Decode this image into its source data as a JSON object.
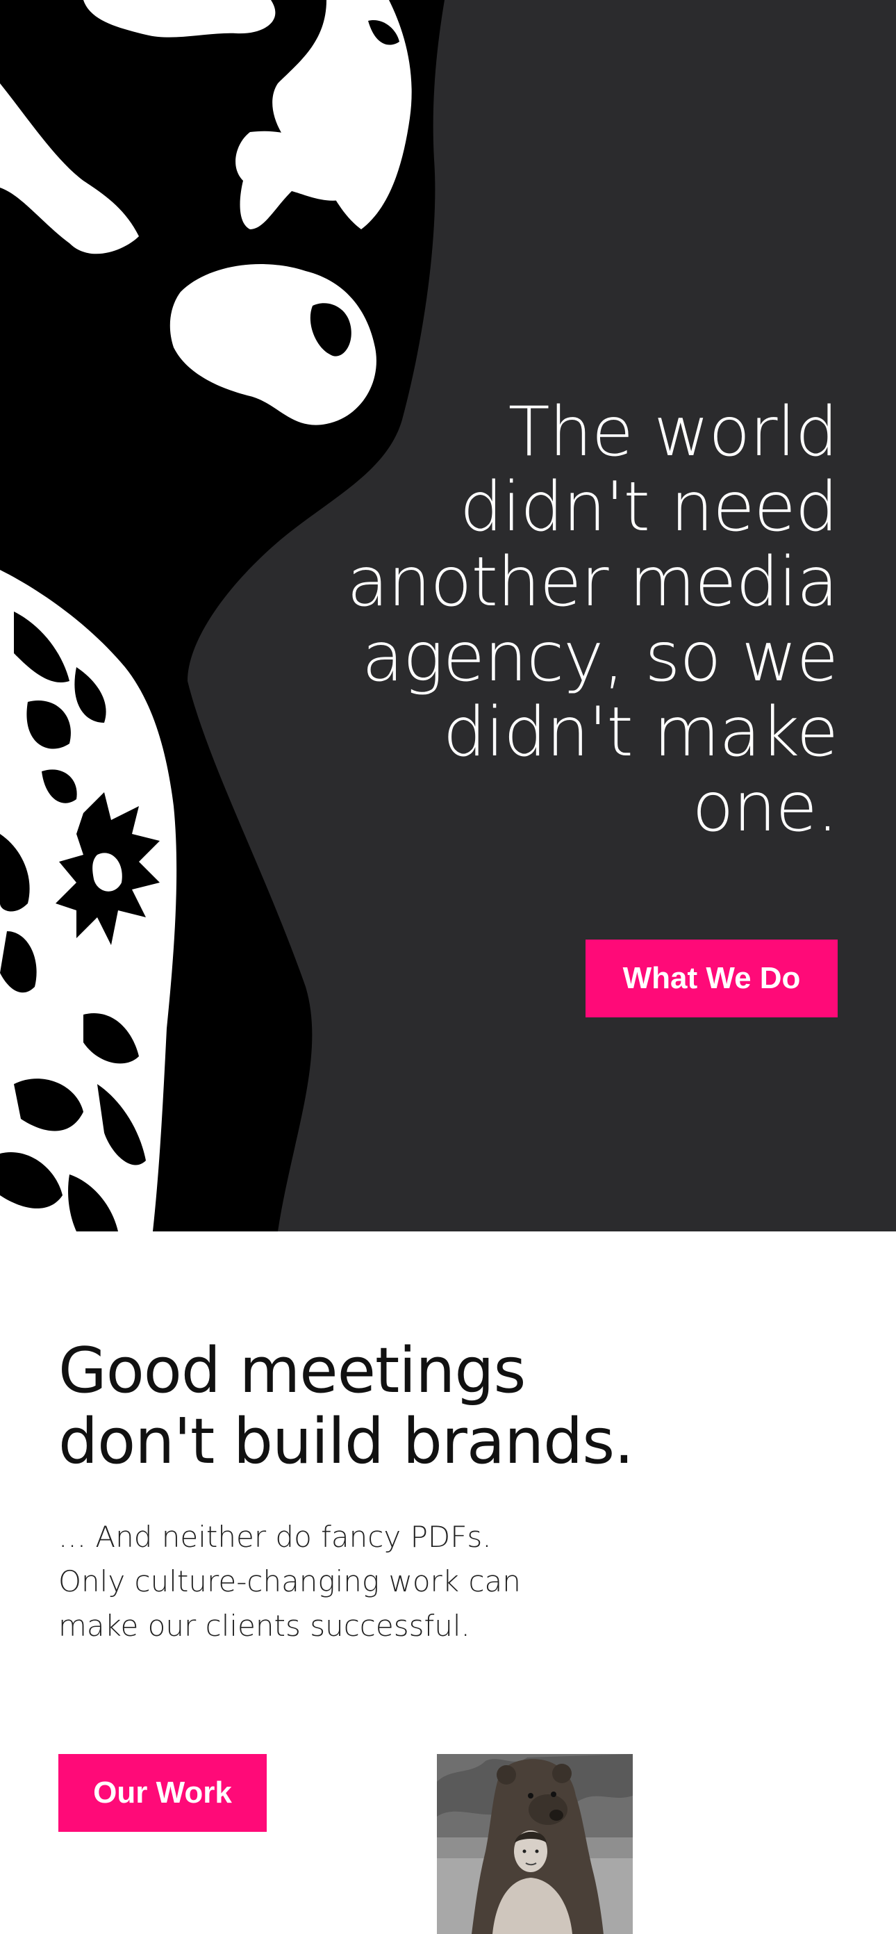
{
  "hero": {
    "headline_lines": [
      "The world",
      "didn't need",
      "another media",
      "agency, so we",
      "didn't make",
      "one."
    ],
    "cta_label": "What We Do",
    "background_color": "#2b2b2d",
    "art_icon": "tattooed-man-illustration"
  },
  "intro": {
    "heading_lines": [
      "Good meetings",
      "don't build brands."
    ],
    "body_lines": [
      "... And neither do fancy PDFs.",
      "Only culture-changing work can",
      "make our clients successful."
    ],
    "cta_label": "Our Work",
    "thumbnail_icon": "man-with-bear-photo"
  },
  "colors": {
    "accent": "#ff0a78",
    "text_dark": "#111111",
    "text_light": "#ffffff"
  }
}
